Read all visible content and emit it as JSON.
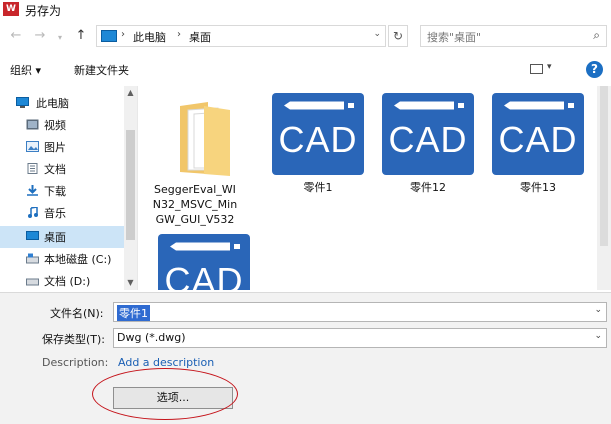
{
  "window": {
    "title": "另存为",
    "app_icon_text": "W"
  },
  "address": {
    "breadcrumbs": [
      "此电脑",
      "桌面"
    ],
    "search_placeholder": "搜索\"桌面\""
  },
  "toolbar": {
    "organize": "组织 ▾",
    "new_folder": "新建文件夹"
  },
  "sidebar": {
    "items": [
      {
        "label": "此电脑",
        "icon": "computer-icon"
      },
      {
        "label": "视频",
        "icon": "video-icon"
      },
      {
        "label": "图片",
        "icon": "image-icon"
      },
      {
        "label": "文档",
        "icon": "document-icon"
      },
      {
        "label": "下载",
        "icon": "download-icon"
      },
      {
        "label": "音乐",
        "icon": "music-icon"
      },
      {
        "label": "桌面",
        "icon": "desktop-icon",
        "selected": true
      },
      {
        "label": "本地磁盘 (C:)",
        "icon": "drive-icon"
      },
      {
        "label": "文档 (D:)",
        "icon": "drive-icon"
      }
    ]
  },
  "files": [
    {
      "name": "SeggerEval_WIN32_MSVC_MinGW_GUI_V532",
      "lines": [
        "SeggerEval_WI",
        "N32_MSVC_Min",
        "GW_GUI_V532"
      ],
      "type": "folder"
    },
    {
      "name": "零件1",
      "type": "cad",
      "icon_text": "CAD"
    },
    {
      "name": "零件12",
      "type": "cad",
      "icon_text": "CAD"
    },
    {
      "name": "零件13",
      "type": "cad",
      "icon_text": "CAD"
    },
    {
      "name": "",
      "type": "cad",
      "icon_text": "CAD"
    }
  ],
  "form": {
    "filename_label": "文件名(N):",
    "filename_value": "零件1",
    "filetype_label": "保存类型(T):",
    "filetype_value": "Dwg (*.dwg)",
    "description_label": "Description:",
    "description_link": "Add a description",
    "options_button": "选项..."
  },
  "colors": {
    "accent": "#2a66b8",
    "selection": "#cce4f7",
    "annotation": "#c5151c"
  }
}
